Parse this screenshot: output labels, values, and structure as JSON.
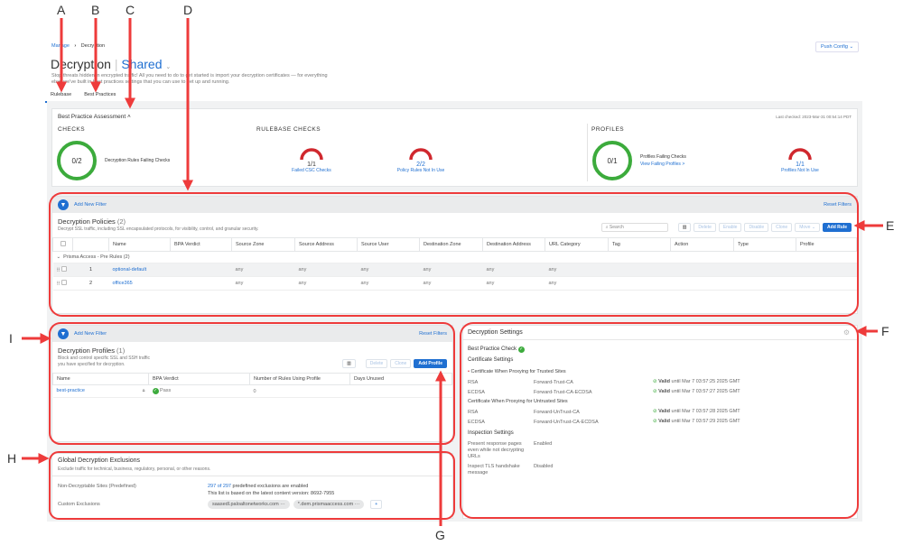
{
  "breadcrumb": {
    "parent": "Manage",
    "current": "Decryption"
  },
  "header": {
    "title": "Decryption",
    "scope": "Shared",
    "description_line1": "Stop threats hidden in encrypted traffic! All you need to do to get started is import your decryption certificates — for everything",
    "description_line2": "else, we've built in best practices settings that you can use to get up and running.",
    "push_config": "Push Config"
  },
  "tabs": [
    {
      "label": "Rulebase",
      "active": true
    },
    {
      "label": "Best Practices",
      "active": false
    }
  ],
  "bpa": {
    "title": "Best Practice Assessment",
    "last_checked": "Last checked: 2023-Mar-31 00:54:14 PDT",
    "checks": {
      "heading": "CHECKS",
      "value": "0/2",
      "label": "Decryption Rules Failing Checks"
    },
    "rulebase": {
      "heading": "RULEBASE CHECKS",
      "items": [
        {
          "value": "1/1",
          "label": "Failed CSC Checks"
        },
        {
          "value": "2/2",
          "label": "Policy Rules Not In Use"
        }
      ]
    },
    "profiles": {
      "heading": "PROFILES",
      "value": "0/1",
      "label": "Profiles Failing Checks",
      "link": "View Failing Profiles >",
      "gauge_value": "1/1",
      "gauge_label": "Profiles Not In Use"
    }
  },
  "policies": {
    "add_filter": "Add New Filter",
    "reset_filters": "Reset Filters",
    "title": "Decryption Policies",
    "count": "(2)",
    "description": "Decrypt SSL traffic, including SSL encapsulated protocols, for visibility, control, and granular security.",
    "search_placeholder": "Search",
    "buttons": {
      "delete": "Delete",
      "enable": "Enable",
      "disable": "Disable",
      "clone": "Clone",
      "move": "Move",
      "add": "Add Rule"
    },
    "columns": [
      "Name",
      "BPA Verdict",
      "Source Zone",
      "Source Address",
      "Source User",
      "Destination Zone",
      "Destination Address",
      "URL Category",
      "Tag",
      "Action",
      "Type",
      "Profile"
    ],
    "group": "Prisma Access - Pre Rules (2)",
    "rows": [
      {
        "num": "1",
        "name": "optional-default",
        "src_zone": "any",
        "src_addr": "any",
        "src_user": "any",
        "dst_zone": "any",
        "dst_addr": "any",
        "url": "any"
      },
      {
        "num": "2",
        "name": "office365",
        "src_zone": "any",
        "src_addr": "any",
        "src_user": "any",
        "dst_zone": "any",
        "dst_addr": "any",
        "url": "any"
      }
    ]
  },
  "profiles": {
    "add_filter": "Add New Filter",
    "reset_filters": "Reset Filters",
    "title": "Decryption Profiles",
    "count": "(1)",
    "description_line1": "Block and control specific SSL and SSH traffic",
    "description_line2": "you have specified for decryption.",
    "buttons": {
      "delete": "Delete",
      "clone": "Clone",
      "add": "Add Profile"
    },
    "columns": [
      "Name",
      "BPA Verdict",
      "Number of Rules Using Profile",
      "Days Unused"
    ],
    "rows": [
      {
        "name": "best-practice",
        "verdict": "Pass",
        "rules": "0",
        "days": ""
      }
    ]
  },
  "settings": {
    "title": "Decryption Settings",
    "bp_check": "Best Practice Check",
    "cert_heading": "Certificate Settings",
    "trusted_heading": "Certificate When Proxying for Trusted Sites",
    "untrusted_heading": "Certificate When Proxying for Untrusted Sites",
    "trusted": [
      {
        "type": "RSA",
        "cert": "Forward-Trust-CA",
        "status": "Valid",
        "until": "until Mar 7 03:57:25 2025 GMT"
      },
      {
        "type": "ECDSA",
        "cert": "Forward-Trust-CA-ECDSA",
        "status": "Valid",
        "until": "until Mar 7 03:57:27 2025 GMT"
      }
    ],
    "untrusted": [
      {
        "type": "RSA",
        "cert": "Forward-UnTrust-CA",
        "status": "Valid",
        "until": "until Mar 7 03:57:28 2025 GMT"
      },
      {
        "type": "ECDSA",
        "cert": "Forward-UnTrust-CA-ECDSA",
        "status": "Valid",
        "until": "until Mar 7 03:57:29 2025 GMT"
      }
    ],
    "inspection_heading": "Inspection Settings",
    "inspection": [
      {
        "label": "Present response pages even while not decrypting URLs",
        "value": "Enabled"
      },
      {
        "label": "Inspect TLS handshake message",
        "value": "Disabled"
      }
    ]
  },
  "exclusions": {
    "title": "Global Decryption Exclusions",
    "description": "Exclude traffic for technical, business, regulatory, personal, or other reasons.",
    "predefined_label": "Non-Decryptable Sites (Predefined)",
    "predefined_link": "297 of 297",
    "predefined_text": "predefined exclusions are enabled",
    "content_version": "This list is based on the latest content version: 8692-7955",
    "custom_label": "Custom Exclusions",
    "custom": [
      "saasedl.paloaltonetworks.com",
      "*.dem.prismaaccess.com"
    ],
    "add": "+"
  },
  "annotations": [
    "A",
    "B",
    "C",
    "D",
    "E",
    "F",
    "G",
    "H",
    "I"
  ],
  "colors": {
    "accent": "#1f6fd1",
    "pass": "#3cab3c",
    "fail": "#d0282e",
    "annotation": "#ee3b3b"
  }
}
